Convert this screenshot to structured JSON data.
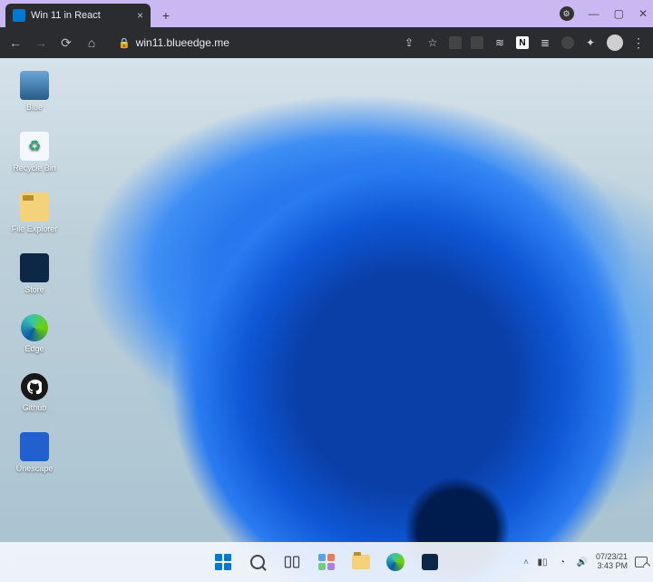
{
  "colors": {
    "accent": "#0078d4"
  },
  "host": {
    "tab_title": "Win 11 in React",
    "url_host": "win11.blueedge.me",
    "extensions": [
      "star-icon",
      "translate-icon",
      "grid-icon",
      "monitor-icon",
      "wifi-icon",
      "notion-icon",
      "list-icon",
      "shield-icon",
      "puzzle-icon"
    ],
    "menu_glyph": "⋮",
    "new_tab_glyph": "+",
    "close_glyph": "×",
    "window_controls": {
      "minimize": "—",
      "maximize": "▢",
      "close": "✕"
    }
  },
  "desktop": {
    "icons": [
      {
        "key": "blue",
        "label": "Blue",
        "glyph_class": "pc",
        "glyph": "🖥"
      },
      {
        "key": "recycle-bin",
        "label": "Recycle Bin",
        "glyph_class": "bin",
        "glyph": "♻"
      },
      {
        "key": "file-explorer",
        "label": "File Explorer",
        "glyph_class": "fexp",
        "glyph": ""
      },
      {
        "key": "store",
        "label": "Store",
        "glyph_class": "store",
        "glyph": "🛍"
      },
      {
        "key": "edge",
        "label": "Edge",
        "glyph_class": "edge",
        "glyph": ""
      },
      {
        "key": "github",
        "label": "Github",
        "glyph_class": "gh",
        "glyph": ""
      },
      {
        "key": "unescape",
        "label": "Unescape",
        "glyph_class": "unescape",
        "glyph": ""
      }
    ]
  },
  "taskbar": {
    "center_items": [
      "start",
      "search",
      "taskview",
      "widgets",
      "file-explorer",
      "edge",
      "store"
    ],
    "tray": {
      "show_hidden_glyph": "˄",
      "icons": [
        "battery-icon",
        "wifi-icon",
        "volume-icon"
      ],
      "date": "07/23/21",
      "time": "3:43 PM"
    }
  }
}
